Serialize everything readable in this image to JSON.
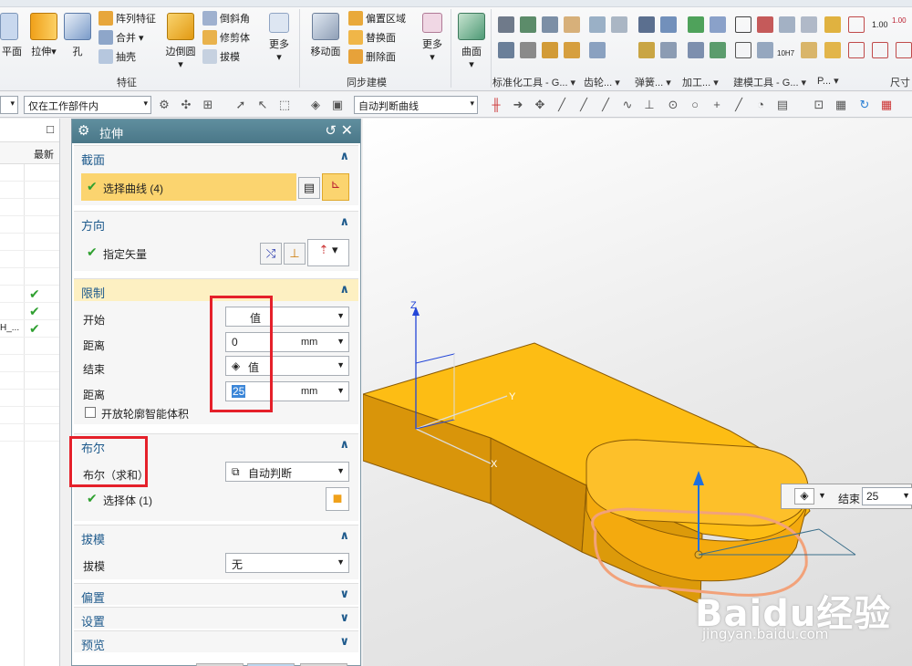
{
  "ribbon": {
    "big_buttons": {
      "plane": "平面",
      "extrude": "拉伸",
      "hole": "孔",
      "edge_blend": "边倒圆",
      "more1": "更多",
      "move_face": "移动面",
      "more2": "更多",
      "surface": "曲面"
    },
    "small_buttons": {
      "pattern_feature": "阵列特征",
      "combine": "合并",
      "shell": "抽壳",
      "chamfer": "倒斜角",
      "trim_body": "修剪体",
      "draft": "拔模",
      "offset_region": "偏置区域",
      "replace_face": "替换面",
      "delete_face": "删除面"
    },
    "group_labels": {
      "feature": "特征",
      "sync_modeling": "同步建模",
      "std_tools": "标准化工具 - G...",
      "gear": "齿轮...",
      "spring": "弹簧...",
      "machining": "加工...",
      "modeling_tools": "建模工具 - G...",
      "p": "P...",
      "dimension": "尺寸"
    },
    "value_1_00": "1.00",
    "value_1_00b": "1.00",
    "value_10h7": "10H7"
  },
  "toolbar": {
    "filter_select": "仅在工作部件内",
    "curve_rule": "自动判断曲线"
  },
  "nav": {
    "latest_header": "最新",
    "row_text": "H_..."
  },
  "dialog": {
    "title": "拉伸",
    "section_curve": {
      "title": "截面",
      "select_curve": "选择曲线 (4)"
    },
    "section_direction": {
      "title": "方向",
      "specify_vector": "指定矢量"
    },
    "section_limits": {
      "title": "限制",
      "start_label": "开始",
      "start_value": "值",
      "distance_label_1": "距离",
      "distance_value_1": "0",
      "unit_1": "mm",
      "end_label": "结束",
      "end_value": "值",
      "distance_label_2": "距离",
      "distance_value_2": "25",
      "unit_2": "mm",
      "open_profile": "开放轮廓智能体积"
    },
    "section_boolean": {
      "title": "布尔",
      "boolean_label": "布尔（求和）",
      "boolean_value": "自动判断",
      "select_body": "选择体 (1)"
    },
    "section_draft": {
      "title": "拔模",
      "draft_label": "拔模",
      "draft_value": "无"
    },
    "section_offset": {
      "title": "偏置"
    },
    "section_settings": {
      "title": "设置"
    },
    "section_preview": {
      "title": "预览"
    }
  },
  "viewport": {
    "axis_x": "X",
    "axis_y": "Y",
    "axis_z": "Z",
    "dim_label": "结束",
    "dim_value": "25"
  },
  "watermark": {
    "brand": "Baidu经验",
    "url": "jingyan.baidu.com"
  },
  "colors": {
    "part_top": "#fdbd14",
    "part_side": "#dc9a0a",
    "dialog_title": "#4f7e8f",
    "highlight": "#fbd46f",
    "red_box": "#e5202a"
  }
}
